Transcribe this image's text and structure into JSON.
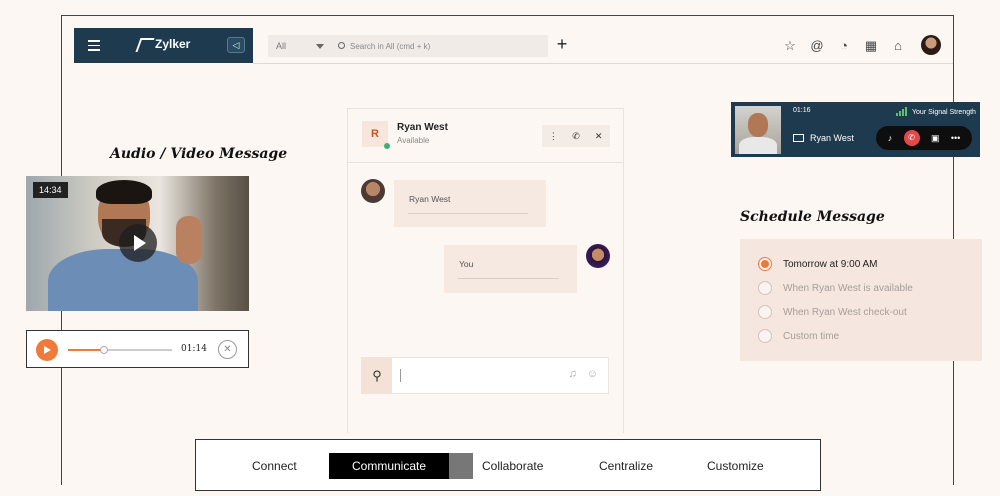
{
  "app": {
    "brand": "Zylker",
    "filter_value": "All",
    "search_placeholder": "Search in All (cmd + k)",
    "top_icons": [
      "star-icon",
      "mention-icon",
      "activity-icon",
      "calendar-icon",
      "store-icon"
    ]
  },
  "audio_video": {
    "title": "Audio / Video Message",
    "video_time": "14:34",
    "audio_duration": "01:14",
    "audio_progress": 0.35
  },
  "chat": {
    "contact_initial": "R",
    "contact_name": "Ryan West",
    "contact_status": "Available",
    "messages": [
      {
        "text": "Ryan West",
        "from": "contact"
      },
      {
        "text": "You",
        "from": "self"
      }
    ]
  },
  "call": {
    "duration": "01:16",
    "signal_text": "Your Signal Strength",
    "name": "Ryan West"
  },
  "schedule": {
    "title": "Schedule Message",
    "options": [
      {
        "label": "Tomorrow at 9:00 AM",
        "selected": true
      },
      {
        "label": "When Ryan West is available",
        "selected": false
      },
      {
        "label": "When Ryan West check-out",
        "selected": false
      },
      {
        "label": "Custom time",
        "selected": false
      }
    ]
  },
  "nav": {
    "tabs": [
      "Connect",
      "Communicate",
      "Collaborate",
      "Centralize",
      "Customize"
    ],
    "active": "Communicate"
  },
  "colors": {
    "accent": "#f07a3a",
    "navy": "#1d3a4e",
    "background": "#fdf7f3"
  }
}
